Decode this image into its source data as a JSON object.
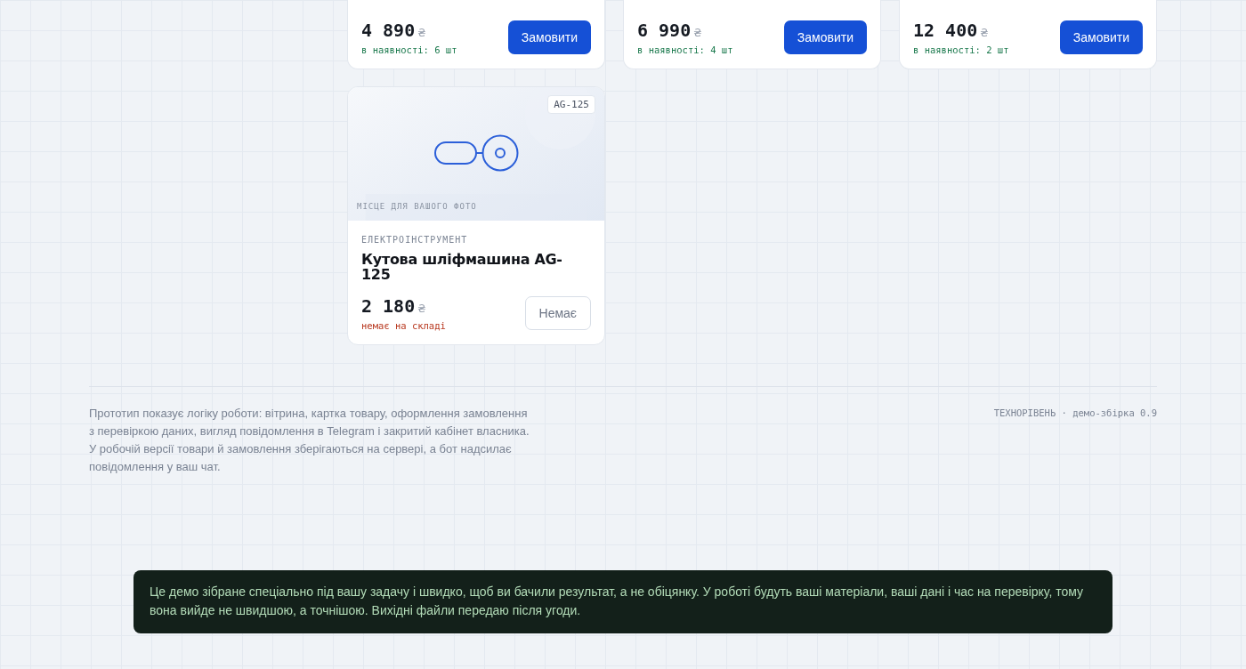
{
  "products": [
    {
      "price": "4 890",
      "currency": "₴",
      "stock": "в наявності: 6 шт",
      "available": true,
      "button": "Замовити"
    },
    {
      "price": "6 990",
      "currency": "₴",
      "stock": "в наявності: 4 шт",
      "available": true,
      "button": "Замовити"
    },
    {
      "price": "12 400",
      "currency": "₴",
      "stock": "в наявності: 2 шт",
      "available": true,
      "button": "Замовити"
    },
    {
      "badge": "AG-125",
      "photo_caption": "МІСЦЕ ДЛЯ ВАШОГО ФОТО",
      "category": "ЕЛЕКТРОІНСТРУМЕНТ",
      "title": "Кутова шліфмашина AG-125",
      "price": "2 180",
      "currency": "₴",
      "stock": "немає на складі",
      "available": false,
      "button": "Немає"
    }
  ],
  "footer": {
    "note": "Прототип показує логіку роботи: вітрина, картка товару, оформлення замовлення з перевіркою даних, вигляд повідомлення в Telegram і закритий кабінет власника. У робочій версії товари й замовлення зберігаються на сервері, а бот надсилає повідомлення у ваш чат.",
    "version": "ТЕХНОРІВЕНЬ · демо-збірка 0.9"
  },
  "toast": {
    "text": "Це демо зібране спеціально під вашу задачу і швидко, щоб ви бачили результат, а не обіцянку. У роботі будуть ваші матеріали, ваші дані і час на перевірку, тому вона вийде не швидшою, а точнішою. Вихідні файли передаю після угоди."
  }
}
